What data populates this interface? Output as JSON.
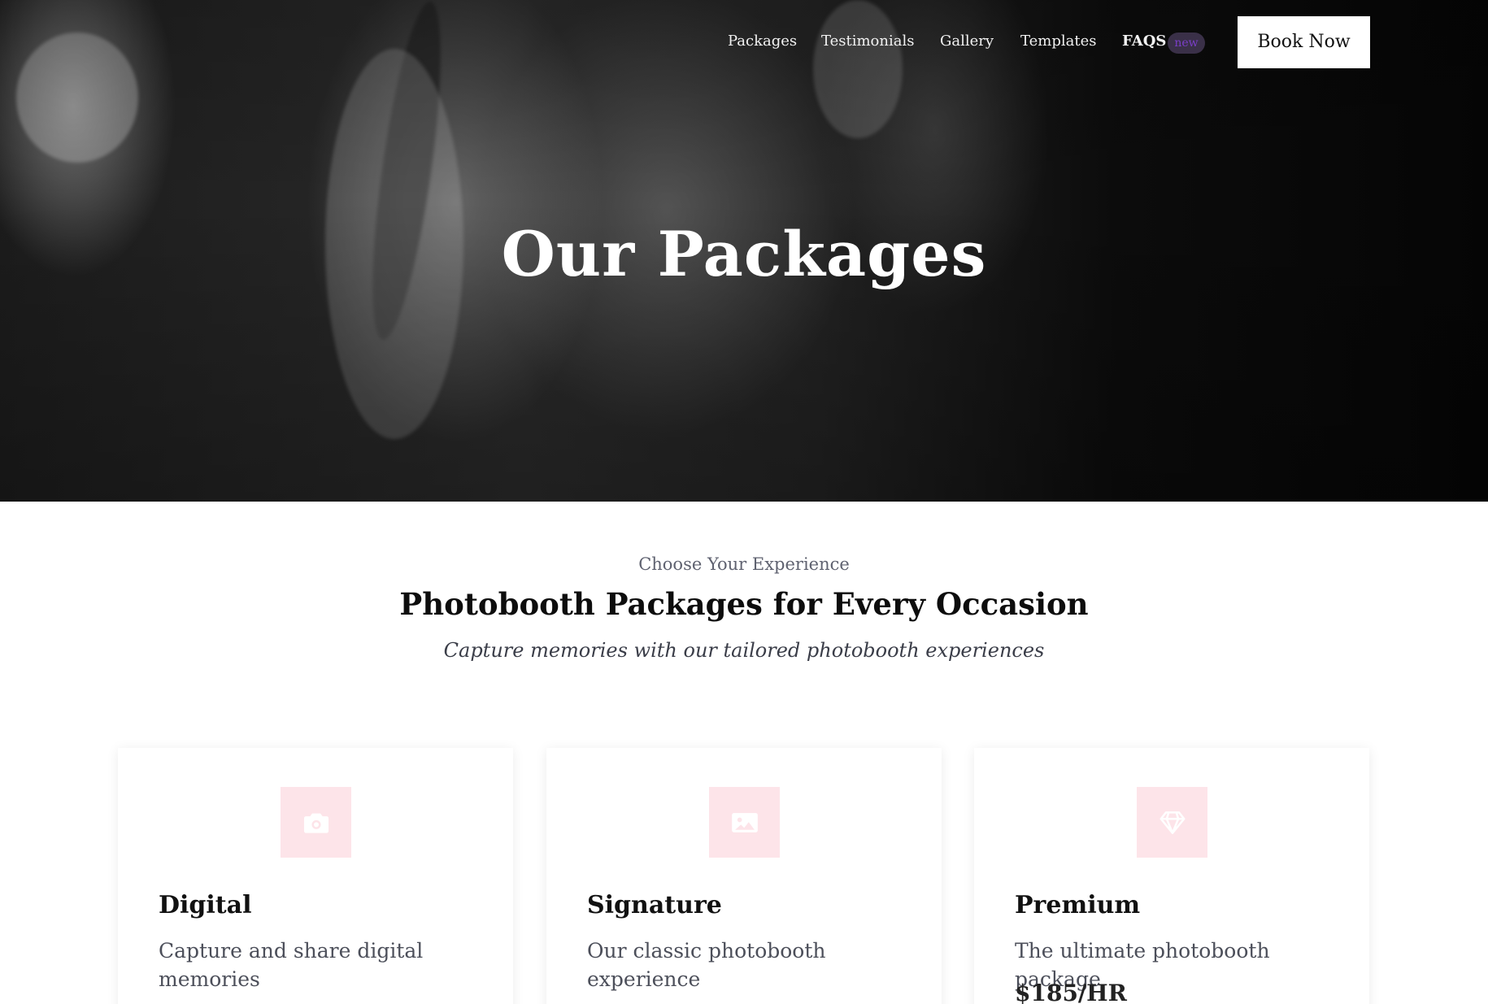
{
  "nav": {
    "items": [
      {
        "label": "Packages"
      },
      {
        "label": "Testimonials"
      },
      {
        "label": "Gallery"
      },
      {
        "label": "Templates"
      },
      {
        "label": "FAQS"
      }
    ],
    "faqs_badge": "new",
    "cta": "Book Now"
  },
  "hero": {
    "title": "Our Packages"
  },
  "intro": {
    "eyebrow": "Choose Your Experience",
    "title": "Photobooth Packages for Every Occasion",
    "subtitle": "Capture memories with our tailored photobooth experiences"
  },
  "packages": [
    {
      "icon": "camera-icon",
      "name": "Digital",
      "description": "Capture and share digital memories"
    },
    {
      "icon": "image-icon",
      "name": "Signature",
      "description": "Our classic photobooth experience"
    },
    {
      "icon": "diamond-icon",
      "name": "Premium",
      "description": "The ultimate photobooth package",
      "price": "$185/HR"
    }
  ],
  "colors": {
    "icon_tile": "#fde4e9",
    "badge_bg": "#3a3048",
    "badge_text": "#7a3ec7"
  }
}
